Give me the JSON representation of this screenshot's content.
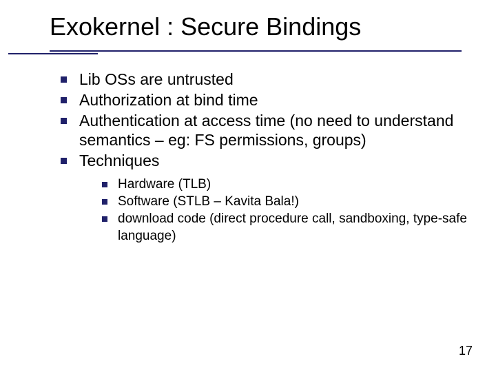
{
  "title": "Exokernel : Secure Bindings",
  "bullets": {
    "b0": "Lib OSs are untrusted",
    "b1": "Authorization at bind time",
    "b2": "Authentication at access time (no need to understand semantics – eg: FS permissions, groups)",
    "b3": "Techniques"
  },
  "subbullets": {
    "s0": "Hardware (TLB)",
    "s1": "Software (STLB – Kavita Bala!)",
    "s2": "download code (direct procedure call, sandboxing, type-safe language)"
  },
  "page_number": "17",
  "colors": {
    "accent": "#20216a"
  }
}
